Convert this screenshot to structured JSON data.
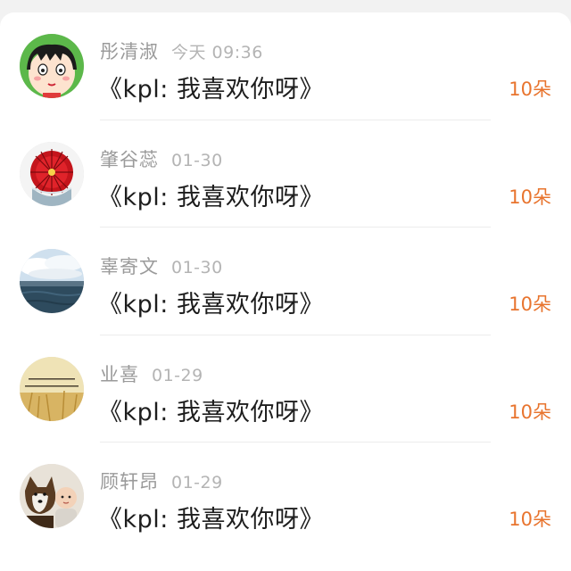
{
  "list": {
    "items": [
      {
        "name": "彤清淑",
        "time": "今天 09:36",
        "gift": "《kpl: 我喜欢你呀》",
        "amount": "10朵",
        "avatar": "cartoon-girl-avatar"
      },
      {
        "name": "肇谷蕊",
        "time": "01-30",
        "gift": "《kpl: 我喜欢你呀》",
        "amount": "10朵",
        "avatar": "red-cactus-avatar"
      },
      {
        "name": "辜寄文",
        "time": "01-30",
        "gift": "《kpl: 我喜欢你呀》",
        "amount": "10朵",
        "avatar": "sea-sky-avatar"
      },
      {
        "name": "业喜",
        "time": "01-29",
        "gift": "《kpl: 我喜欢你呀》",
        "amount": "10朵",
        "avatar": "wheat-field-quote-avatar"
      },
      {
        "name": "顾轩昂",
        "time": "01-29",
        "gift": "《kpl: 我喜欢你呀》",
        "amount": "10朵",
        "avatar": "dog-and-baby-avatar"
      }
    ]
  },
  "colors": {
    "amount": "#e8742e",
    "name": "#9a9a9a",
    "time": "#b4b4b4",
    "gift": "#1d1d1d"
  }
}
